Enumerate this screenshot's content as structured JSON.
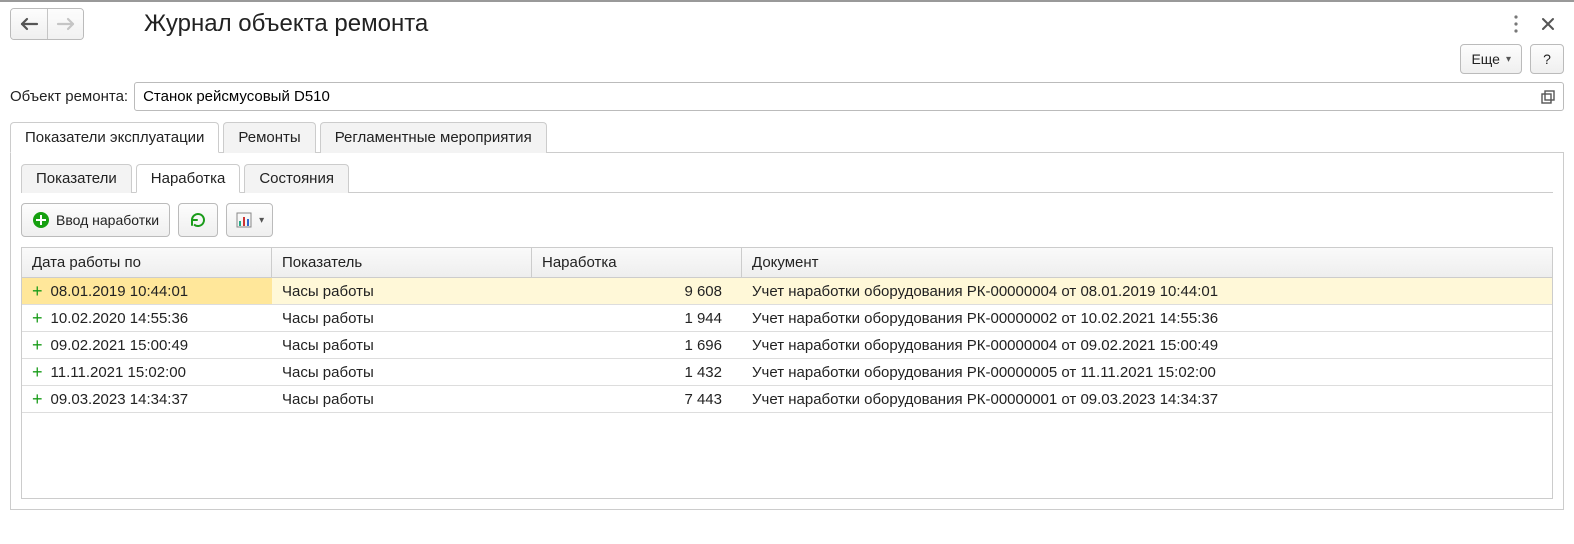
{
  "header": {
    "title": "Журнал объекта ремонта",
    "more_label": "Еще",
    "help_label": "?"
  },
  "field": {
    "label": "Объект ремонта:",
    "value": "Станок рейсмусовый D510"
  },
  "outer_tabs": [
    {
      "label": "Показатели эксплуатации",
      "active": true
    },
    {
      "label": "Ремонты",
      "active": false
    },
    {
      "label": "Регламентные мероприятия",
      "active": false
    }
  ],
  "inner_tabs": [
    {
      "label": "Показатели",
      "active": false
    },
    {
      "label": "Наработка",
      "active": true
    },
    {
      "label": "Состояния",
      "active": false
    }
  ],
  "toolbar": {
    "add_label": "Ввод наработки"
  },
  "table": {
    "headers": {
      "date": "Дата работы по",
      "indicator": "Показатель",
      "value": "Наработка",
      "document": "Документ"
    },
    "rows": [
      {
        "date": "08.01.2019 10:44:01",
        "indicator": "Часы работы",
        "value": "9 608",
        "document": "Учет наработки оборудования РК-00000004 от 08.01.2019 10:44:01",
        "selected": true
      },
      {
        "date": "10.02.2020 14:55:36",
        "indicator": "Часы работы",
        "value": "1 944",
        "document": "Учет наработки оборудования РК-00000002 от 10.02.2021 14:55:36",
        "selected": false
      },
      {
        "date": "09.02.2021 15:00:49",
        "indicator": "Часы работы",
        "value": "1 696",
        "document": "Учет наработки оборудования РК-00000004 от 09.02.2021 15:00:49",
        "selected": false
      },
      {
        "date": "11.11.2021 15:02:00",
        "indicator": "Часы работы",
        "value": "1 432",
        "document": "Учет наработки оборудования РК-00000005 от 11.11.2021 15:02:00",
        "selected": false
      },
      {
        "date": "09.03.2023 14:34:37",
        "indicator": "Часы работы",
        "value": "7 443",
        "document": "Учет наработки оборудования РК-00000001 от 09.03.2023 14:34:37",
        "selected": false
      }
    ]
  }
}
